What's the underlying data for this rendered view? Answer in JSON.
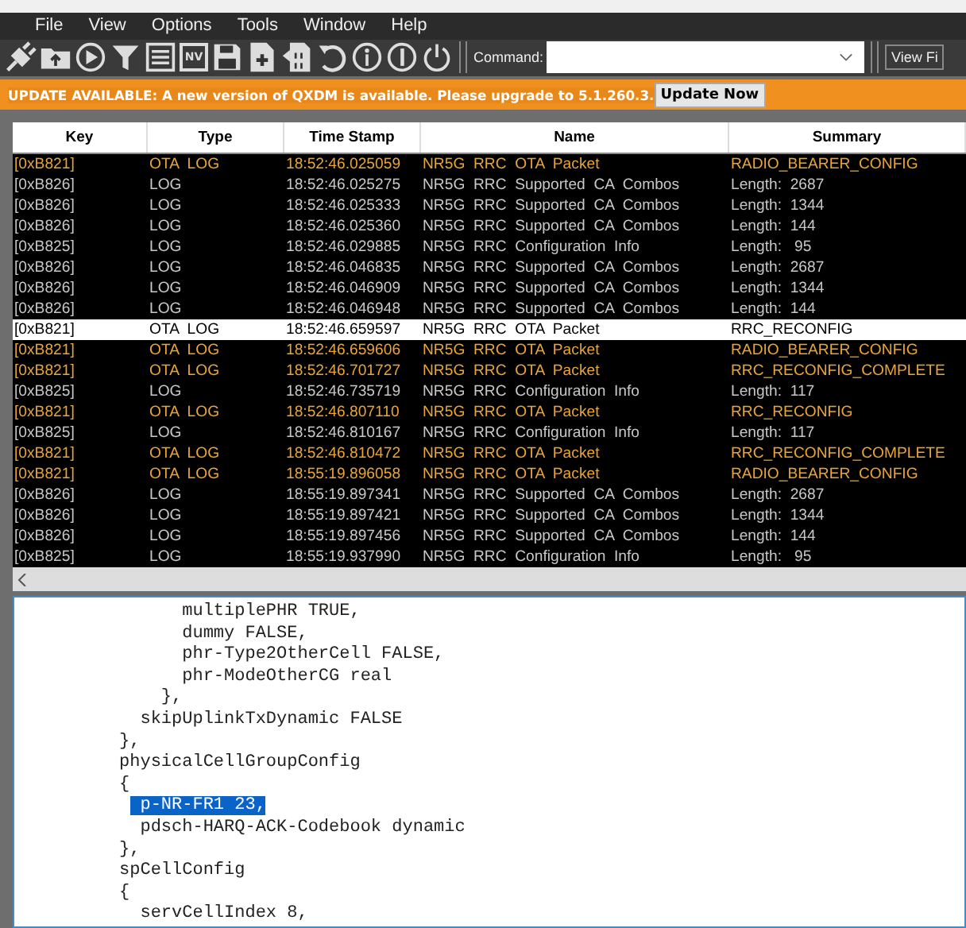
{
  "menu": [
    "File",
    "View",
    "Options",
    "Tools",
    "Window",
    "Help"
  ],
  "toolbar": {
    "nv_label": "NV",
    "command_label": "Command:",
    "view_button": "View Fi"
  },
  "banner": {
    "message": "UPDATE AVAILABLE: A new version of QXDM is available. Please upgrade to 5.1.260.3.",
    "button": "Update Now"
  },
  "table": {
    "columns": [
      "Key",
      "Type",
      "Time Stamp",
      "Name",
      "Summary"
    ],
    "rows": [
      {
        "kind": "ota",
        "selected": false,
        "cells": [
          "[0xB821]",
          "OTA  LOG",
          "18:52:46.025059",
          "NR5G  RRC  OTA  Packet",
          "RADIO_BEARER_CONFIG"
        ]
      },
      {
        "kind": "log",
        "selected": false,
        "cells": [
          "[0xB826]",
          "LOG",
          "18:52:46.025275",
          "NR5G  RRC  Supported  CA  Combos",
          "Length:  2687"
        ]
      },
      {
        "kind": "log",
        "selected": false,
        "cells": [
          "[0xB826]",
          "LOG",
          "18:52:46.025333",
          "NR5G  RRC  Supported  CA  Combos",
          "Length:  1344"
        ]
      },
      {
        "kind": "log",
        "selected": false,
        "cells": [
          "[0xB826]",
          "LOG",
          "18:52:46.025360",
          "NR5G  RRC  Supported  CA  Combos",
          "Length:  144"
        ]
      },
      {
        "kind": "log",
        "selected": false,
        "cells": [
          "[0xB825]",
          "LOG",
          "18:52:46.029885",
          "NR5G  RRC  Configuration  Info",
          "Length:   95"
        ]
      },
      {
        "kind": "log",
        "selected": false,
        "cells": [
          "[0xB826]",
          "LOG",
          "18:52:46.046835",
          "NR5G  RRC  Supported  CA  Combos",
          "Length:  2687"
        ]
      },
      {
        "kind": "log",
        "selected": false,
        "cells": [
          "[0xB826]",
          "LOG",
          "18:52:46.046909",
          "NR5G  RRC  Supported  CA  Combos",
          "Length:  1344"
        ]
      },
      {
        "kind": "log",
        "selected": false,
        "cells": [
          "[0xB826]",
          "LOG",
          "18:52:46.046948",
          "NR5G  RRC  Supported  CA  Combos",
          "Length:  144"
        ]
      },
      {
        "kind": "ota",
        "selected": true,
        "cells": [
          "[0xB821]",
          "OTA  LOG",
          "18:52:46.659597",
          "NR5G  RRC  OTA  Packet",
          "RRC_RECONFIG"
        ]
      },
      {
        "kind": "ota",
        "selected": false,
        "cells": [
          "[0xB821]",
          "OTA  LOG",
          "18:52:46.659606",
          "NR5G  RRC  OTA  Packet",
          "RADIO_BEARER_CONFIG"
        ]
      },
      {
        "kind": "ota",
        "selected": false,
        "cells": [
          "[0xB821]",
          "OTA  LOG",
          "18:52:46.701727",
          "NR5G  RRC  OTA  Packet",
          "RRC_RECONFIG_COMPLETE"
        ]
      },
      {
        "kind": "log",
        "selected": false,
        "cells": [
          "[0xB825]",
          "LOG",
          "18:52:46.735719",
          "NR5G  RRC  Configuration  Info",
          "Length:  117"
        ]
      },
      {
        "kind": "ota",
        "selected": false,
        "cells": [
          "[0xB821]",
          "OTA  LOG",
          "18:52:46.807110",
          "NR5G  RRC  OTA  Packet",
          "RRC_RECONFIG"
        ]
      },
      {
        "kind": "log",
        "selected": false,
        "cells": [
          "[0xB825]",
          "LOG",
          "18:52:46.810167",
          "NR5G  RRC  Configuration  Info",
          "Length:  117"
        ]
      },
      {
        "kind": "ota",
        "selected": false,
        "cells": [
          "[0xB821]",
          "OTA  LOG",
          "18:52:46.810472",
          "NR5G  RRC  OTA  Packet",
          "RRC_RECONFIG_COMPLETE"
        ]
      },
      {
        "kind": "ota",
        "selected": false,
        "cells": [
          "[0xB821]",
          "OTA  LOG",
          "18:55:19.896058",
          "NR5G  RRC  OTA  Packet",
          "RADIO_BEARER_CONFIG"
        ]
      },
      {
        "kind": "log",
        "selected": false,
        "cells": [
          "[0xB826]",
          "LOG",
          "18:55:19.897341",
          "NR5G  RRC  Supported  CA  Combos",
          "Length:  2687"
        ]
      },
      {
        "kind": "log",
        "selected": false,
        "cells": [
          "[0xB826]",
          "LOG",
          "18:55:19.897421",
          "NR5G  RRC  Supported  CA  Combos",
          "Length:  1344"
        ]
      },
      {
        "kind": "log",
        "selected": false,
        "cells": [
          "[0xB826]",
          "LOG",
          "18:55:19.897456",
          "NR5G  RRC  Supported  CA  Combos",
          "Length:  144"
        ]
      },
      {
        "kind": "log",
        "selected": false,
        "cells": [
          "[0xB825]",
          "LOG",
          "18:55:19.937990",
          "NR5G  RRC  Configuration  Info",
          "Length:   95"
        ]
      }
    ]
  },
  "detail": {
    "lines": [
      {
        "text": "                multiplePHR TRUE,",
        "selected": false
      },
      {
        "text": "                dummy FALSE,",
        "selected": false
      },
      {
        "text": "                phr-Type2OtherCell FALSE,",
        "selected": false
      },
      {
        "text": "                phr-ModeOtherCG real",
        "selected": false
      },
      {
        "text": "              },",
        "selected": false
      },
      {
        "text": "            skipUplinkTxDynamic FALSE",
        "selected": false
      },
      {
        "text": "          },",
        "selected": false
      },
      {
        "text": "          physicalCellGroupConfig",
        "selected": false
      },
      {
        "text": "          {",
        "selected": false
      },
      {
        "text": "            p-NR-FR1 23,",
        "selected": true
      },
      {
        "text": "            pdsch-HARQ-ACK-Codebook dynamic",
        "selected": false
      },
      {
        "text": "          },",
        "selected": false
      },
      {
        "text": "          spCellConfig",
        "selected": false
      },
      {
        "text": "          {",
        "selected": false
      },
      {
        "text": "            servCellIndex 8,",
        "selected": false
      }
    ]
  }
}
